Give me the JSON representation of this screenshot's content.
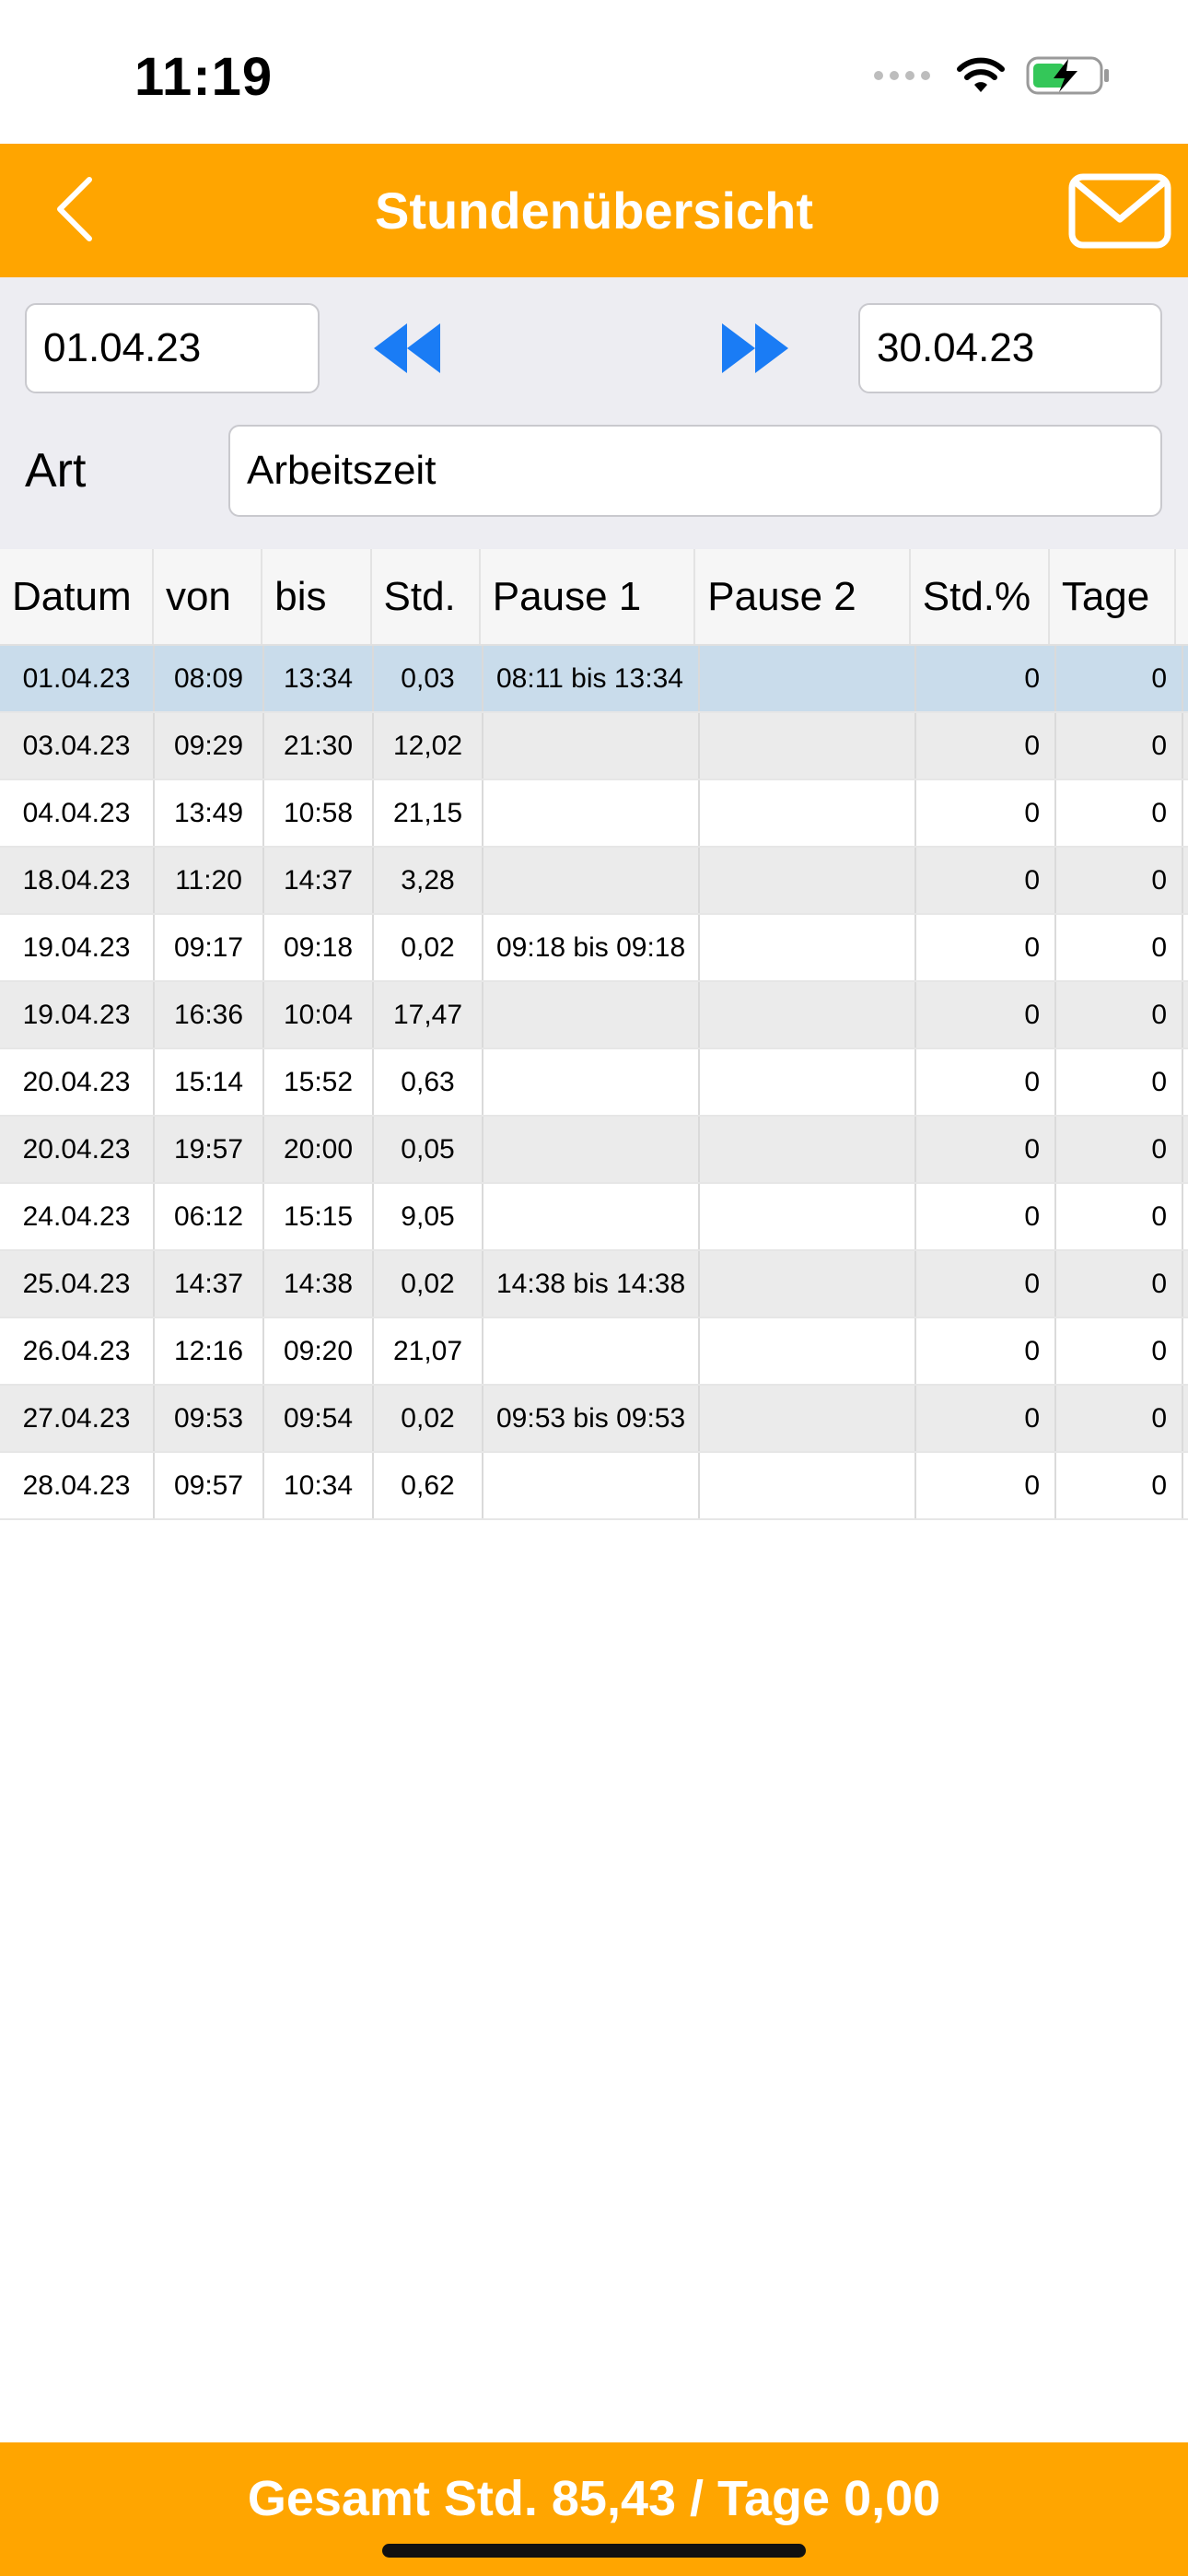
{
  "status_bar": {
    "time": "11:19",
    "battery_color": "#34C759"
  },
  "header": {
    "title": "Stundenübersicht",
    "background": "#FFA500"
  },
  "filters": {
    "date_from": "01.04.23",
    "date_to": "30.04.23",
    "art_label": "Art",
    "art_value": "Arbeitszeit"
  },
  "table": {
    "columns": [
      "Datum",
      "von",
      "bis",
      "Std.",
      "Pause 1",
      "Pause 2",
      "Std.%",
      "Tage"
    ],
    "rows": [
      {
        "datum": "01.04.23",
        "von": "08:09",
        "bis": "13:34",
        "std": "0,03",
        "pause1": "08:11 bis 13:34",
        "pause2": "",
        "stdp": "0",
        "tage": "0"
      },
      {
        "datum": "03.04.23",
        "von": "09:29",
        "bis": "21:30",
        "std": "12,02",
        "pause1": "",
        "pause2": "",
        "stdp": "0",
        "tage": "0"
      },
      {
        "datum": "04.04.23",
        "von": "13:49",
        "bis": "10:58",
        "std": "21,15",
        "pause1": "",
        "pause2": "",
        "stdp": "0",
        "tage": "0"
      },
      {
        "datum": "18.04.23",
        "von": "11:20",
        "bis": "14:37",
        "std": "3,28",
        "pause1": "",
        "pause2": "",
        "stdp": "0",
        "tage": "0"
      },
      {
        "datum": "19.04.23",
        "von": "09:17",
        "bis": "09:18",
        "std": "0,02",
        "pause1": "09:18 bis 09:18",
        "pause2": "",
        "stdp": "0",
        "tage": "0"
      },
      {
        "datum": "19.04.23",
        "von": "16:36",
        "bis": "10:04",
        "std": "17,47",
        "pause1": "",
        "pause2": "",
        "stdp": "0",
        "tage": "0"
      },
      {
        "datum": "20.04.23",
        "von": "15:14",
        "bis": "15:52",
        "std": "0,63",
        "pause1": "",
        "pause2": "",
        "stdp": "0",
        "tage": "0"
      },
      {
        "datum": "20.04.23",
        "von": "19:57",
        "bis": "20:00",
        "std": "0,05",
        "pause1": "",
        "pause2": "",
        "stdp": "0",
        "tage": "0"
      },
      {
        "datum": "24.04.23",
        "von": "06:12",
        "bis": "15:15",
        "std": "9,05",
        "pause1": "",
        "pause2": "",
        "stdp": "0",
        "tage": "0"
      },
      {
        "datum": "25.04.23",
        "von": "14:37",
        "bis": "14:38",
        "std": "0,02",
        "pause1": "14:38 bis 14:38",
        "pause2": "",
        "stdp": "0",
        "tage": "0"
      },
      {
        "datum": "26.04.23",
        "von": "12:16",
        "bis": "09:20",
        "std": "21,07",
        "pause1": "",
        "pause2": "",
        "stdp": "0",
        "tage": "0"
      },
      {
        "datum": "27.04.23",
        "von": "09:53",
        "bis": "09:54",
        "std": "0,02",
        "pause1": "09:53 bis 09:53",
        "pause2": "",
        "stdp": "0",
        "tage": "0"
      },
      {
        "datum": "28.04.23",
        "von": "09:57",
        "bis": "10:34",
        "std": "0,62",
        "pause1": "",
        "pause2": "",
        "stdp": "0",
        "tage": "0"
      }
    ]
  },
  "footer": {
    "summary": "Gesamt Std. 85,43 / Tage 0,00"
  },
  "icons": {
    "back": "chevron-left-icon",
    "mail": "mail-icon",
    "prev": "rewind-icon",
    "next": "fast-forward-icon",
    "wifi": "wifi-icon",
    "battery": "battery-charging-icon",
    "signal": "cellular-signal-icon"
  },
  "colors": {
    "accent": "#FFA500",
    "arrow": "#1A7CF5",
    "selected_row": "#C9DCEB"
  }
}
